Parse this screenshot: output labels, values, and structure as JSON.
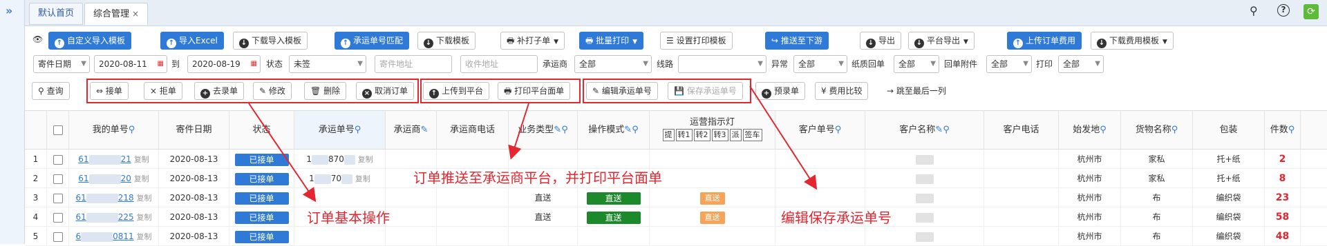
{
  "tabs": [
    {
      "label": "默认首页"
    },
    {
      "label": "综合管理",
      "close": "×"
    }
  ],
  "topright_icons": [
    "search-icon",
    "help-icon",
    "refresh-icon"
  ],
  "toolbar1": {
    "custom_import_template": "自定义导入模板",
    "import_excel": "导入Excel",
    "download_import_template": "下载导入模板",
    "carrier_no_match": "承运单号匹配",
    "download_template": "下载模板",
    "reprint_sheet": "补打子单",
    "batch_print": "批量打印",
    "set_print_template": "设置打印模板",
    "push_downstream": "推送至下游",
    "export": "导出",
    "platform_export": "平台导出",
    "upload_order_fee": "上传订单费用",
    "download_fee_template": "下载费用模板"
  },
  "filters": {
    "date_type": "寄件日期",
    "date_from": "2020-08-11",
    "to_label": "到",
    "date_to": "2020-08-19",
    "status_label": "状态",
    "status_value": "未签",
    "sender_addr_placeholder": "寄件地址",
    "receiver_addr_placeholder": "收件地址",
    "carrier_label": "承运商",
    "carrier_value": "全部",
    "route_label": "线路",
    "route_value": "",
    "exception_label": "异常",
    "exception_value": "全部",
    "paper_receipt_label": "纸质回单",
    "paper_receipt_value": "全部",
    "receipt_attach_label": "回单附件",
    "receipt_attach_value": "全部",
    "print_label": "打印",
    "print_value": "全部"
  },
  "toolbar2": {
    "query": "查询",
    "accept": "接单",
    "reject": "拒单",
    "cancel_accept": "去录单",
    "modify": "修改",
    "delete": "删除",
    "cancel_order": "取消订单",
    "upload_platform": "上传到平台",
    "print_platform_sheet": "打印平台面单",
    "edit_carrier_no": "编辑承运单号",
    "save_carrier_no": "保存承运单号",
    "pre_entry": "预录单",
    "fee_compare": "费用比较",
    "jump_last_col": "跳至最后一列"
  },
  "columns": {
    "my_no": "我的单号",
    "send_date": "寄件日期",
    "status": "状态",
    "carrier_no": "承运单号",
    "carrier": "承运商",
    "carrier_phone": "承运商电话",
    "biz_type": "业务类型",
    "op_mode": "操作模式",
    "transport_light": "运营指示灯",
    "light_tags": [
      "提",
      "转1",
      "转2",
      "转3",
      "派",
      "签车"
    ],
    "customer_no": "客户单号",
    "customer_name": "客户名称",
    "customer_phone": "客户电话",
    "origin": "始发地",
    "goods_name": "货物名称",
    "package": "包装",
    "qty": "件数"
  },
  "rows": [
    {
      "idx": "1",
      "my_no_start": "61",
      "my_no_end": "21",
      "copy": "复制",
      "date": "2020-08-13",
      "status": "已接单",
      "carrier_no_start": "1",
      "carrier_no_mid": "870",
      "carrier_copy": "复制",
      "biz": "",
      "op": "",
      "light": "",
      "origin": "杭州市",
      "goods": "家私",
      "pack": "托+纸",
      "qty": "2"
    },
    {
      "idx": "2",
      "my_no_start": "61",
      "my_no_end": "20",
      "copy": "复制",
      "date": "2020-08-13",
      "status": "已接单",
      "carrier_no_start": "1",
      "carrier_no_mid": "70",
      "carrier_copy": "复制",
      "biz": "",
      "op": "",
      "light": "",
      "origin": "杭州市",
      "goods": "家私",
      "pack": "托+纸",
      "qty": "8"
    },
    {
      "idx": "3",
      "my_no_start": "61",
      "my_no_end": "218",
      "copy": "复制",
      "date": "2020-08-13",
      "status": "已接单",
      "carrier_no_start": "",
      "carrier_no_mid": "",
      "carrier_copy": "",
      "biz": "直送",
      "op": "直送",
      "light": "直送",
      "origin": "杭州市",
      "goods": "布",
      "pack": "编织袋",
      "qty": "23"
    },
    {
      "idx": "4",
      "my_no_start": "61",
      "my_no_end": "225",
      "copy": "复制",
      "date": "2020-08-13",
      "status": "已接单",
      "carrier_no_start": "",
      "carrier_no_mid": "",
      "carrier_copy": "",
      "biz": "直送",
      "op": "直送",
      "light": "直送",
      "origin": "杭州市",
      "goods": "布",
      "pack": "编织袋",
      "qty": "58"
    },
    {
      "idx": "5",
      "my_no_start": "6",
      "my_no_end": "0811",
      "copy": "复制",
      "date": "2020-08-13",
      "status": "已接单",
      "carrier_no_start": "",
      "carrier_no_mid": "",
      "carrier_copy": "",
      "biz": "",
      "op": "",
      "light": "",
      "origin": "杭州市",
      "goods": "布",
      "pack": "编织袋",
      "qty": "48"
    }
  ],
  "annotations": {
    "basic_ops": "订单基本操作",
    "push_print": "订单推送至承运商平台，并打印平台面单",
    "edit_save": "编辑保存承运单号"
  },
  "colors": {
    "accent": "#2f7ad6",
    "annotation": "#e3262f",
    "green": "#1c8a2a",
    "orange": "#f5a45a",
    "qty_red": "#e3262f"
  }
}
